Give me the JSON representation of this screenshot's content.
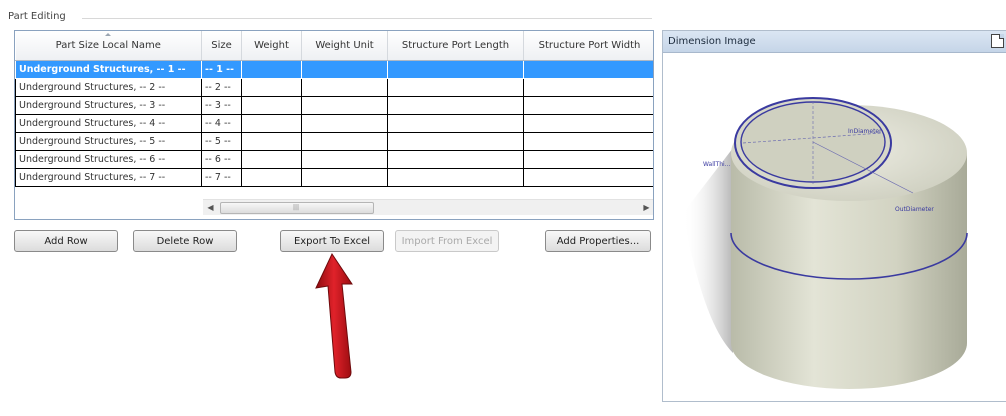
{
  "group_title": "Part Editing",
  "grid": {
    "columns": [
      "Part Size Local Name",
      "Size",
      "Weight",
      "Weight Unit",
      "Structure Port Length",
      "Structure Port Width"
    ],
    "rows": [
      {
        "name": "Underground Structures, -- 1 --",
        "size": "-- 1 --",
        "selected": true
      },
      {
        "name": "Underground Structures, -- 2 --",
        "size": "-- 2 --"
      },
      {
        "name": "Underground Structures, -- 3 --",
        "size": "-- 3 --"
      },
      {
        "name": "Underground Structures, -- 4 --",
        "size": "-- 4 --"
      },
      {
        "name": "Underground Structures, -- 5 --",
        "size": "-- 5 --"
      },
      {
        "name": "Underground Structures, -- 6 --",
        "size": "-- 6 --"
      },
      {
        "name": "Underground Structures, -- 7 --",
        "size": "-- 7 --"
      }
    ],
    "hscroll": {
      "left": "◀",
      "right": "▶",
      "grip": "|||"
    }
  },
  "buttons": {
    "add_row": "Add Row",
    "delete_row": "Delete Row",
    "export_excel": "Export To Excel",
    "import_excel": "Import From Excel",
    "add_properties": "Add Properties..."
  },
  "image_panel": {
    "title": "Dimension Image",
    "dim_labels": {
      "inner_diameter": "InDiameter",
      "wall": "WallThi...",
      "outer_diameter": "OutDiameter"
    }
  },
  "colors": {
    "selection": "#3399ff",
    "annotation_arrow": "#d2161b",
    "dimension_lines": "#3a3aa0"
  }
}
